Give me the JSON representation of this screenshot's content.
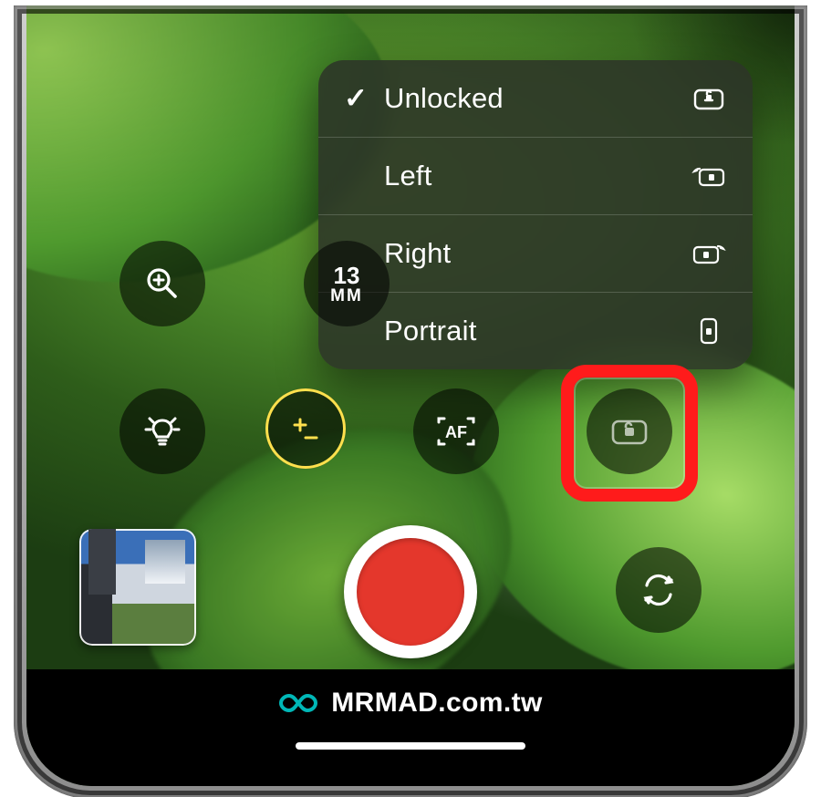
{
  "menu": {
    "items": [
      {
        "label": "Unlocked",
        "checked": true,
        "icon": "rotation-unlock-icon"
      },
      {
        "label": "Left",
        "checked": false,
        "icon": "rotation-lock-left-icon"
      },
      {
        "label": "Right",
        "checked": false,
        "icon": "rotation-lock-right-icon"
      },
      {
        "label": "Portrait",
        "checked": false,
        "icon": "rotation-lock-portrait-icon"
      }
    ]
  },
  "controls": {
    "zoom_label": "Zoom",
    "focal_number": "13",
    "focal_unit": "MM",
    "light_label": "Light",
    "exposure_label": "Exposure",
    "af_label": "AF",
    "orientation_label": "Orientation Lock",
    "flip_label": "Switch Camera",
    "record_label": "Record",
    "thumbnail_label": "Last clip"
  },
  "footer": {
    "brand_main": "MRMAD",
    "brand_domain": ".com.tw"
  },
  "colors": {
    "highlight": "#ff1b1b",
    "exposure_accent": "#ffe04d",
    "record": "#e4372c",
    "brand_accent": "#00b7b7"
  }
}
